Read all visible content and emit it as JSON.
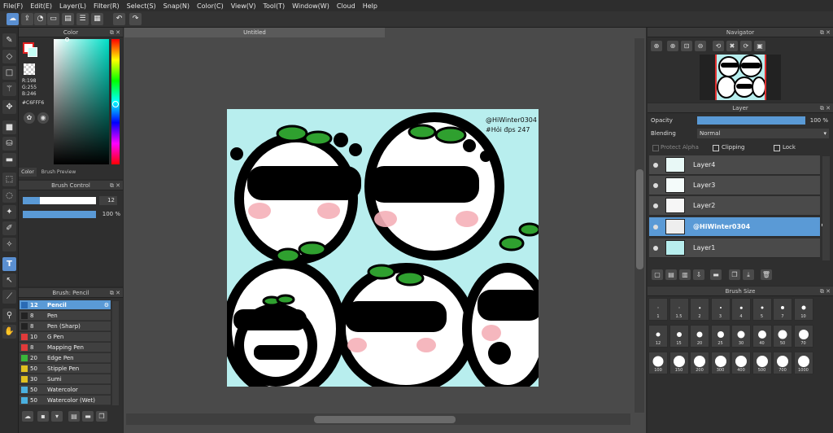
{
  "menu": [
    "File(F)",
    "Edit(E)",
    "Layer(L)",
    "Filter(R)",
    "Select(S)",
    "Snap(N)",
    "Color(C)",
    "View(V)",
    "Tool(T)",
    "Window(W)",
    "Cloud",
    "Help"
  ],
  "document": {
    "tab_title": "Untitled",
    "text_line1": "@HiWinter0304",
    "text_line2": "#Hỏi đps 247"
  },
  "color_panel": {
    "title": "Color",
    "r": "R:198",
    "g": "G:255",
    "b": "B:246",
    "hex": "#C6FFF6",
    "tab_color": "Color",
    "tab_brush_preview": "Brush Preview",
    "fg_color": "#C6FFF6"
  },
  "brush_control": {
    "title": "Brush Control",
    "size": "12",
    "opacity": "100 %"
  },
  "brush_list": {
    "title": "Brush: Pencil",
    "items": [
      {
        "size": "12",
        "name": "Pencil",
        "color": "#2a6bb5"
      },
      {
        "size": "8",
        "name": "Pen",
        "color": "#222222"
      },
      {
        "size": "8",
        "name": "Pen (Sharp)",
        "color": "#222222"
      },
      {
        "size": "10",
        "name": "G Pen",
        "color": "#e03a3a"
      },
      {
        "size": "8",
        "name": "Mapping Pen",
        "color": "#e03a3a"
      },
      {
        "size": "20",
        "name": "Edge Pen",
        "color": "#3ab53a"
      },
      {
        "size": "50",
        "name": "Stipple Pen",
        "color": "#e0c020"
      },
      {
        "size": "30",
        "name": "Sumi",
        "color": "#e0c020"
      },
      {
        "size": "50",
        "name": "Watercolor",
        "color": "#4ab0e0"
      },
      {
        "size": "50",
        "name": "Watercolor (Wet)",
        "color": "#4ab0e0"
      }
    ]
  },
  "navigator": {
    "title": "Navigator"
  },
  "layer_panel": {
    "title": "Layer",
    "opacity_label": "Opacity",
    "opacity_value": "100 %",
    "blending_label": "Blending",
    "blending_value": "Normal",
    "protect_alpha": "Protect Alpha",
    "clipping": "Clipping",
    "lock": "Lock",
    "layers": [
      {
        "name": "Layer4",
        "selected": false
      },
      {
        "name": "Layer3",
        "selected": false
      },
      {
        "name": "Layer2",
        "selected": false
      },
      {
        "name": "@HiWinter0304",
        "selected": true
      },
      {
        "name": "Layer1",
        "selected": false
      }
    ]
  },
  "brush_size_panel": {
    "title": "Brush Size",
    "sizes": [
      "1",
      "1.5",
      "2",
      "3",
      "4",
      "5",
      "7",
      "10",
      "12",
      "15",
      "20",
      "25",
      "30",
      "40",
      "50",
      "70",
      "100",
      "150",
      "200",
      "300",
      "400",
      "500",
      "700",
      "1000"
    ]
  }
}
